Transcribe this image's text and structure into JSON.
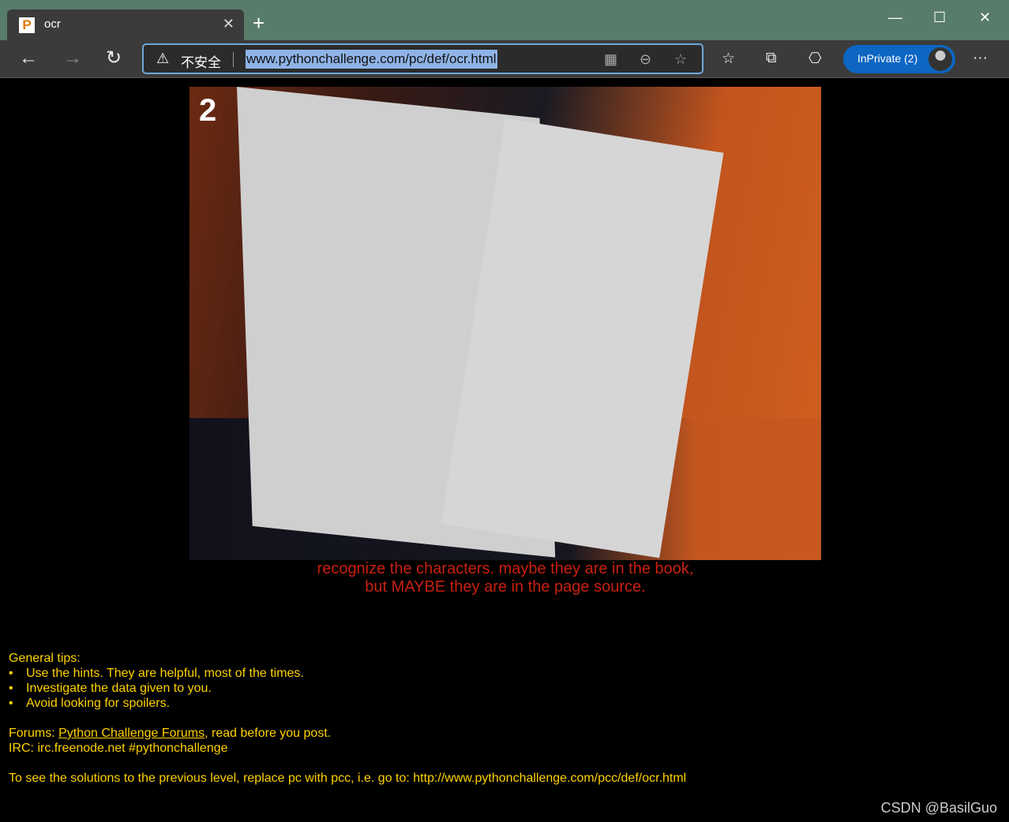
{
  "browser": {
    "tab_title": "ocr",
    "security_label": "不安全",
    "url": "www.pythonchallenge.com/pc/def/ocr.html",
    "inprivate_label": "InPrivate (2)"
  },
  "page": {
    "image_number": "2",
    "hint_line1": "recognize the characters. maybe they are in the book,",
    "hint_line2": "but MAYBE they are in the page source.",
    "tips_heading": "General tips:",
    "tips": [
      "Use the hints. They are helpful, most of the times.",
      "Investigate the data given to you.",
      "Avoid looking for spoilers."
    ],
    "forums_prefix": "Forums: ",
    "forums_link": "Python Challenge Forums",
    "forums_suffix": ", read before you post.",
    "irc": "IRC: irc.freenode.net #pythonchallenge",
    "solutions": "To see the solutions to the previous level, replace pc with pcc, i.e. go to: http://www.pythonchallenge.com/pcc/def/ocr.html"
  },
  "watermark": "CSDN @BasilGuo"
}
